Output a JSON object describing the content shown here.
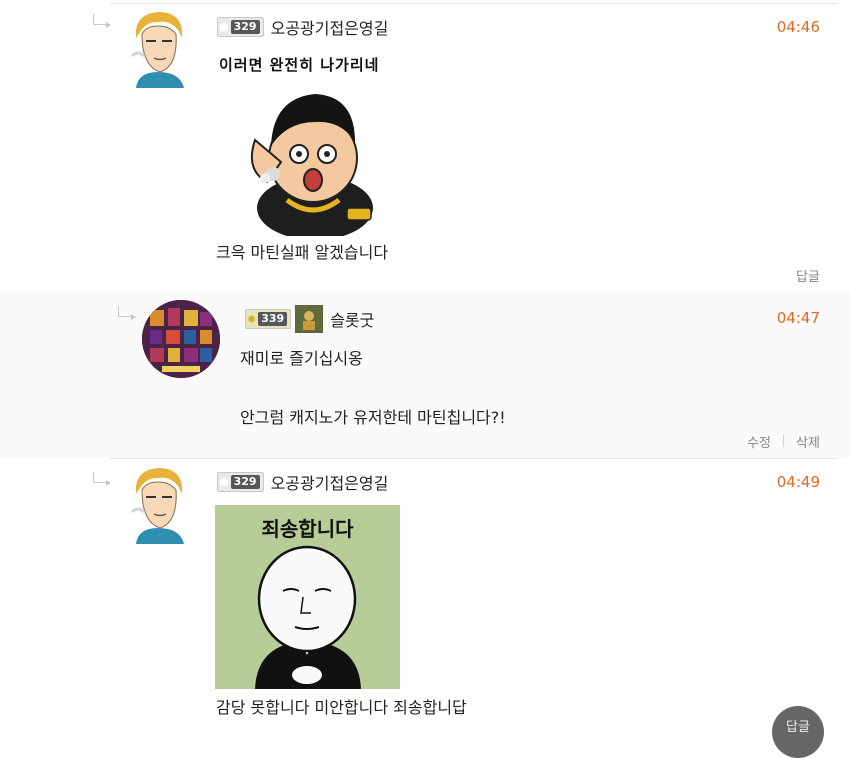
{
  "comments": [
    {
      "author": "오공광기접은영길",
      "level": "329",
      "time": "04:46",
      "sticker_caption": "이러면 완전히 나가리네",
      "text": "크윽 마틴실패 알겠습니다",
      "actions": [
        "답글"
      ]
    },
    {
      "author": "슬롯굿",
      "level": "339",
      "time": "04:47",
      "lines": [
        "재미로 즐기십시옹",
        "안그럼 캐지노가 유저한테 마틴칩니다?!"
      ],
      "actions": [
        "수정",
        "삭제"
      ]
    },
    {
      "author": "오공광기접은영길",
      "level": "329",
      "time": "04:49",
      "sticker_caption": "죄송합니다",
      "text": "감당 못합니다 미안합니다 죄송합니답",
      "actions": []
    }
  ],
  "floating_button": {
    "label": "답글"
  },
  "colors": {
    "time": "#e06a24",
    "sticker2_bg": "#b6cd98",
    "separator": "#e3e3e3"
  }
}
